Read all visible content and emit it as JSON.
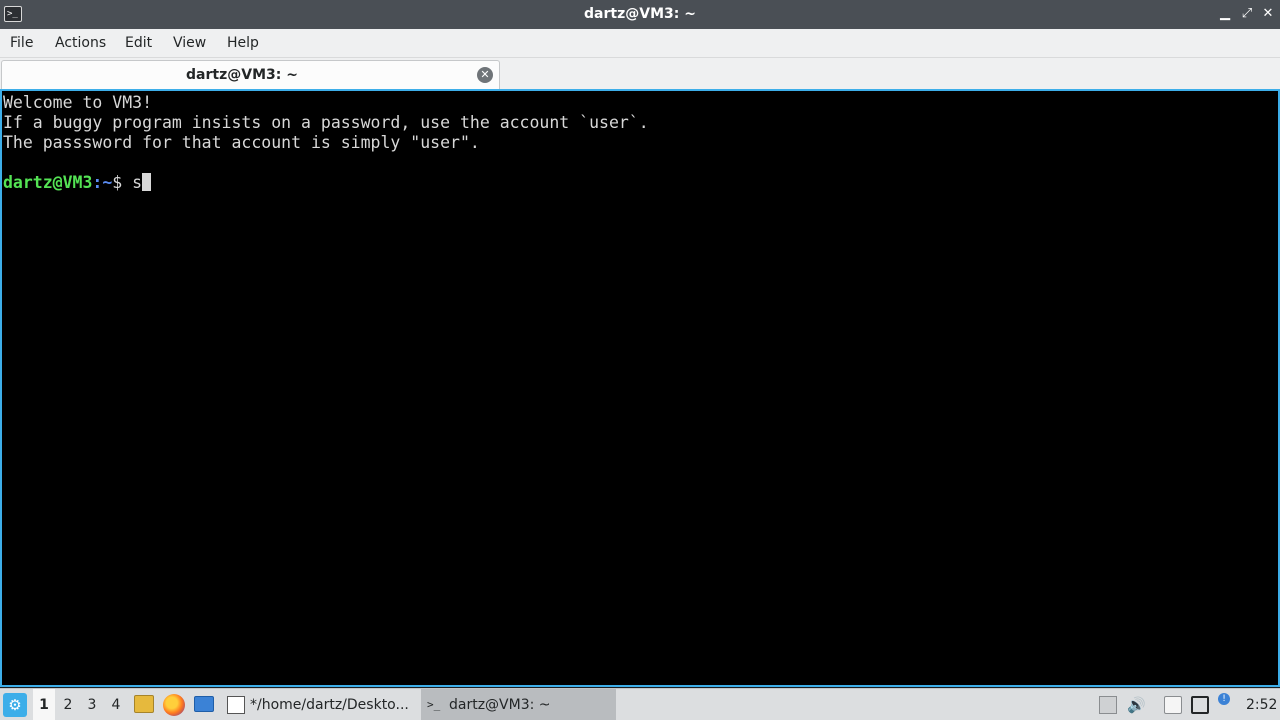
{
  "window": {
    "title": "dartz@VM3: ~",
    "icon": "terminal-icon",
    "buttons": {
      "minimize": "▁",
      "maximize": "⤢",
      "close": "✕"
    }
  },
  "menu": {
    "file": "File",
    "actions": "Actions",
    "edit": "Edit",
    "view": "View",
    "help": "Help"
  },
  "tab": {
    "label": "dartz@VM3: ~",
    "close_glyph": "✕"
  },
  "terminal": {
    "lines": [
      "Welcome to VM3!",
      "If a buggy program insists on a password, use the account `user`.",
      "The passsword for that account is simply \"user\"."
    ],
    "prompt_user": "dartz@VM3",
    "prompt_sep": ":",
    "prompt_path": "~",
    "prompt_symbol": "$ ",
    "input": "s"
  },
  "taskbar": {
    "start_glyph": "⚙",
    "workspaces": [
      "1",
      "2",
      "3",
      "4"
    ],
    "tasks": [
      {
        "label": "*/home/dartz/Deskto...",
        "icon": "text-editor-icon"
      },
      {
        "label": "dartz@VM3: ~",
        "icon": "terminal-icon",
        "icon_glyph": ">_"
      }
    ],
    "tray": {
      "volume_glyph": "🔊",
      "update_glyph": "!"
    },
    "clock": "2:52"
  },
  "colors": {
    "accent": "#3daee9",
    "terminal_bg": "#000000",
    "prompt_user": "#54e354",
    "prompt_path": "#5b8cf3"
  }
}
